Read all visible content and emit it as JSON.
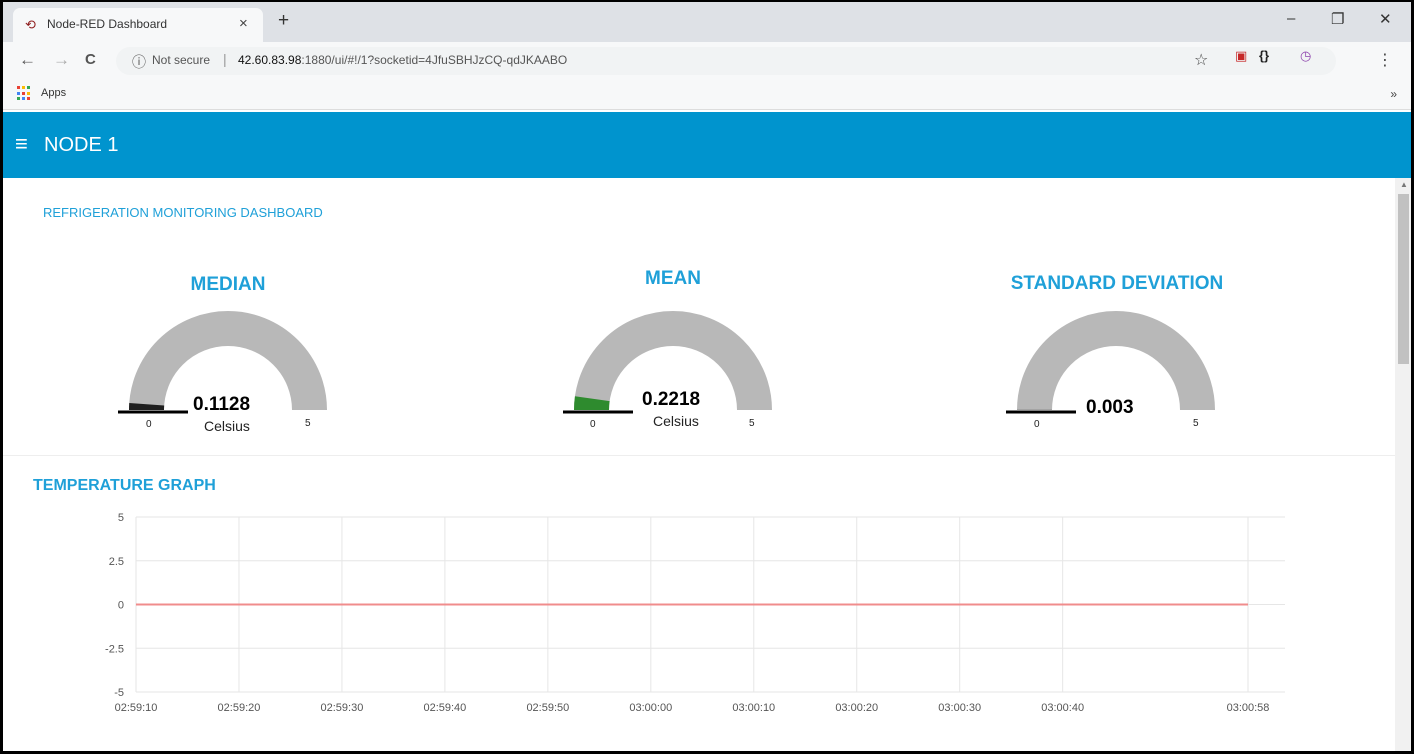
{
  "browser": {
    "tab_title": "Node-RED Dashboard",
    "tab_close": "×",
    "new_tab": "+",
    "window_minimize": "–",
    "window_restore": "❐",
    "window_close": "✕",
    "nav_back": "←",
    "nav_forward": "→",
    "nav_reload": "C",
    "security_label": "Not secure",
    "url_host": "42.60.83.98",
    "url_path": ":1880/ui/#!/1?socketid=4JfuSBHJzCQ-qdJKAABO",
    "bookmark_apps": "Apps",
    "bookmarks_more": "»"
  },
  "dashboard": {
    "title": "NODE 1",
    "header_color": "#0094ce",
    "accent_color": "#1fa0d8",
    "section_title": "REFRIGERATION MONITORING DASHBOARD",
    "gauges": [
      {
        "title": "MEDIAN",
        "value": "0.1128",
        "units": "Celsius",
        "min": "0",
        "max": "5",
        "level": 0.1128,
        "fill_color": "#1f1f1f"
      },
      {
        "title": "MEAN",
        "value": "0.2218",
        "units": "Celsius",
        "min": "0",
        "max": "5",
        "level": 0.2218,
        "fill_color": "#2e8b2e"
      },
      {
        "title": "STANDARD DEVIATION",
        "value": "0.003",
        "units": "",
        "min": "0",
        "max": "5",
        "level": 0.003,
        "fill_color": "#1f1f1f"
      }
    ],
    "graph_title": "TEMPERATURE GRAPH"
  },
  "chart_data": {
    "type": "line",
    "title": "TEMPERATURE GRAPH",
    "xlabel": "",
    "ylabel": "",
    "ylim": [
      -5,
      5
    ],
    "y_ticks": [
      "5",
      "2.5",
      "0",
      "-2.5",
      "-5"
    ],
    "x_ticks": [
      "02:59:10",
      "02:59:20",
      "02:59:30",
      "02:59:40",
      "02:59:50",
      "03:00:00",
      "03:00:10",
      "03:00:20",
      "03:00:30",
      "03:00:40",
      "03:00:58"
    ],
    "grid": true,
    "series": [
      {
        "color": "#f08c8c",
        "x": [
          "02:59:10",
          "03:00:58"
        ],
        "values": [
          0,
          0
        ]
      }
    ]
  }
}
